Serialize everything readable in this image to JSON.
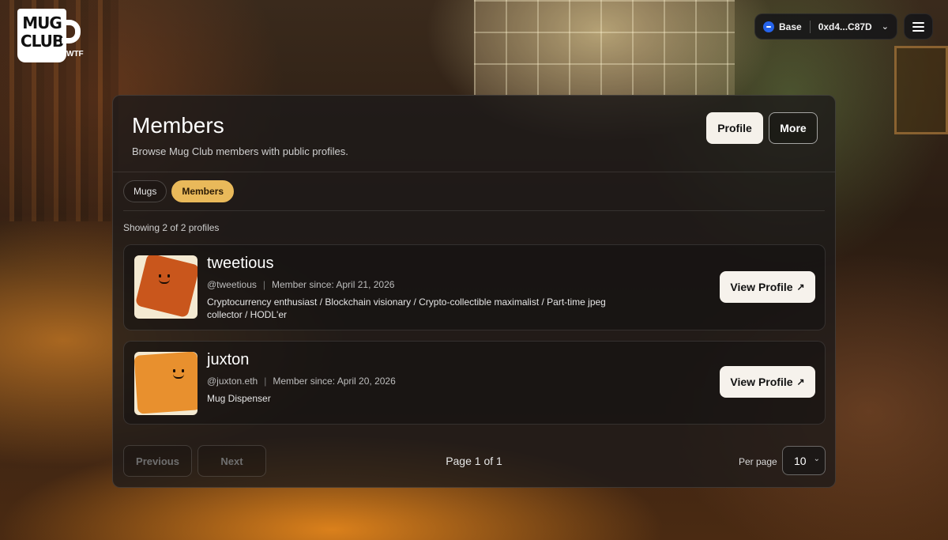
{
  "logo": {
    "line1": "MUG",
    "line2": "CLUB",
    "suffix": "WTF"
  },
  "wallet": {
    "network": "Base",
    "address": "0xd4...C87D",
    "network_icon": "base-network-icon",
    "chevron_icon": "chevron-down-icon"
  },
  "menu_icon": "hamburger-menu-icon",
  "page": {
    "title": "Members",
    "subtitle": "Browse Mug Club members with public profiles.",
    "profile_label": "Profile",
    "more_label": "More"
  },
  "tabs": [
    {
      "label": "Mugs",
      "active": false
    },
    {
      "label": "Members",
      "active": true
    }
  ],
  "showing_text": "Showing 2 of 2 profiles",
  "members": [
    {
      "name": "tweetious",
      "handle": "@tweetious",
      "separator": "|",
      "member_since": "Member since: April 21, 2026",
      "bio": "Cryptocurrency enthusiast / Blockchain visionary / Crypto-collectible maximalist / Part-time jpeg collector / HODL'er",
      "button_label": "View Profile",
      "button_icon": "↗"
    },
    {
      "name": "juxton",
      "handle": "@juxton.eth",
      "separator": "|",
      "member_since": "Member since: April 20, 2026",
      "bio": "Mug Dispenser",
      "button_label": "View Profile",
      "button_icon": "↗"
    }
  ],
  "pagination": {
    "prev_label": "Previous",
    "next_label": "Next",
    "page_info": "Page 1 of 1",
    "per_page_label": "Per page",
    "per_page_value": "10"
  }
}
